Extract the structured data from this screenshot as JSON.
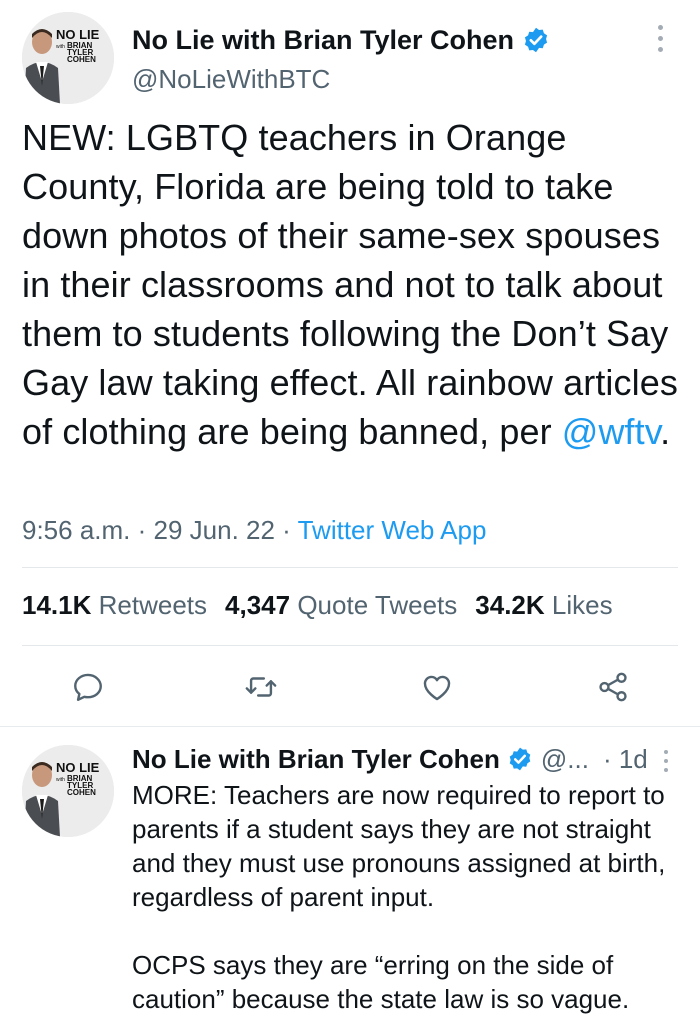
{
  "tweet": {
    "author_name": "No Lie with Brian Tyler Cohen",
    "handle": "@NoLieWithBTC",
    "text_before_mention": "NEW: LGBTQ teachers in Orange County, Florida are being told to take down photos of their same-sex spouses in their classrooms and not to talk about them to students following the Don’t Say Gay law taking effect. All rainbow articles of clothing are being banned, per ",
    "mention": "@wftv",
    "text_after_mention": ".",
    "time": "9:56 a.m.",
    "date": "29 Jun. 22",
    "separator": " · ",
    "source": "Twitter Web App",
    "stats": {
      "retweets_count": "14.1K",
      "retweets_label": "Retweets",
      "quote_tweets_count": "4,347",
      "quote_tweets_label": "Quote Tweets",
      "likes_count": "34.2K",
      "likes_label": "Likes"
    }
  },
  "reply": {
    "author_name": "No Lie with Brian Tyler Cohen",
    "handle": "@...",
    "time": "· 1d",
    "paragraph_1": "MORE: Teachers are now required to report to parents if a student says they are not straight and they must use pronouns assigned at birth, regardless of parent input.",
    "paragraph_2": "OCPS says they are “erring on the side of caution” because the state law is so vague."
  },
  "avatar_logo": {
    "line1": "NO LIE",
    "small": "with",
    "line2": "BRIAN",
    "line3": "TYLER",
    "line4": "COHEN"
  },
  "icons": {
    "verified": "verified-badge-icon",
    "more": "more-options-icon",
    "reply": "reply-icon",
    "retweet": "retweet-icon",
    "like": "like-icon",
    "share": "share-icon"
  },
  "colors": {
    "accent": "#1d9bf0",
    "text": "#0f1419",
    "secondary": "#536471",
    "divider": "#e4e8eb"
  }
}
